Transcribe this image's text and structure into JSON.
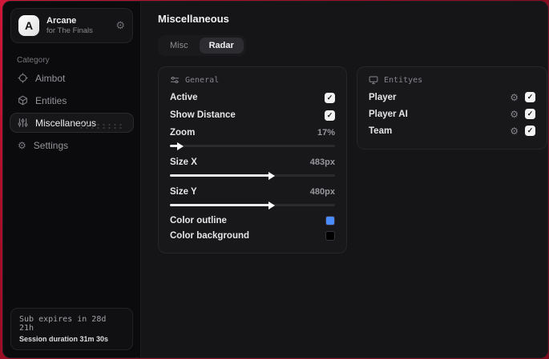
{
  "sidebar": {
    "logo_letter": "A",
    "app_name": "Arcane",
    "app_subtitle": "for The Finals",
    "category_label": "Category",
    "nav_items": [
      {
        "label": "Aimbot"
      },
      {
        "label": "Entities"
      },
      {
        "label": "Miscellaneous"
      },
      {
        "label": "Settings"
      }
    ],
    "footer": {
      "subscription": "Sub expires in 28d 21h",
      "session": "Session duration 31m 30s"
    }
  },
  "main": {
    "title": "Miscellaneous",
    "tabs": [
      {
        "label": "Misc"
      },
      {
        "label": "Radar"
      }
    ],
    "general_panel": {
      "title": "General",
      "toggles": [
        {
          "label": "Active",
          "checked": true
        },
        {
          "label": "Show Distance",
          "checked": true
        }
      ],
      "sliders": [
        {
          "label": "Zoom",
          "value": "17%",
          "percent": 7
        },
        {
          "label": "Size X",
          "value": "483px",
          "percent": 62
        },
        {
          "label": "Size Y",
          "value": "480px",
          "percent": 62
        }
      ],
      "color_rows": [
        {
          "label": "Color outline",
          "color": "#4a8cfb"
        },
        {
          "label": "Color background",
          "color": "#000000"
        }
      ]
    },
    "entities_panel": {
      "title": "Entityes",
      "rows": [
        {
          "label": "Player",
          "checked": true
        },
        {
          "label": "Player AI",
          "checked": true
        },
        {
          "label": "Team",
          "checked": true
        }
      ]
    }
  },
  "icons": {
    "gear": "⚙",
    "check": "✓"
  },
  "colors": {
    "accent_background": "#a60f29",
    "outline_swatch": "#4a8cfb",
    "background_swatch": "#000000"
  }
}
